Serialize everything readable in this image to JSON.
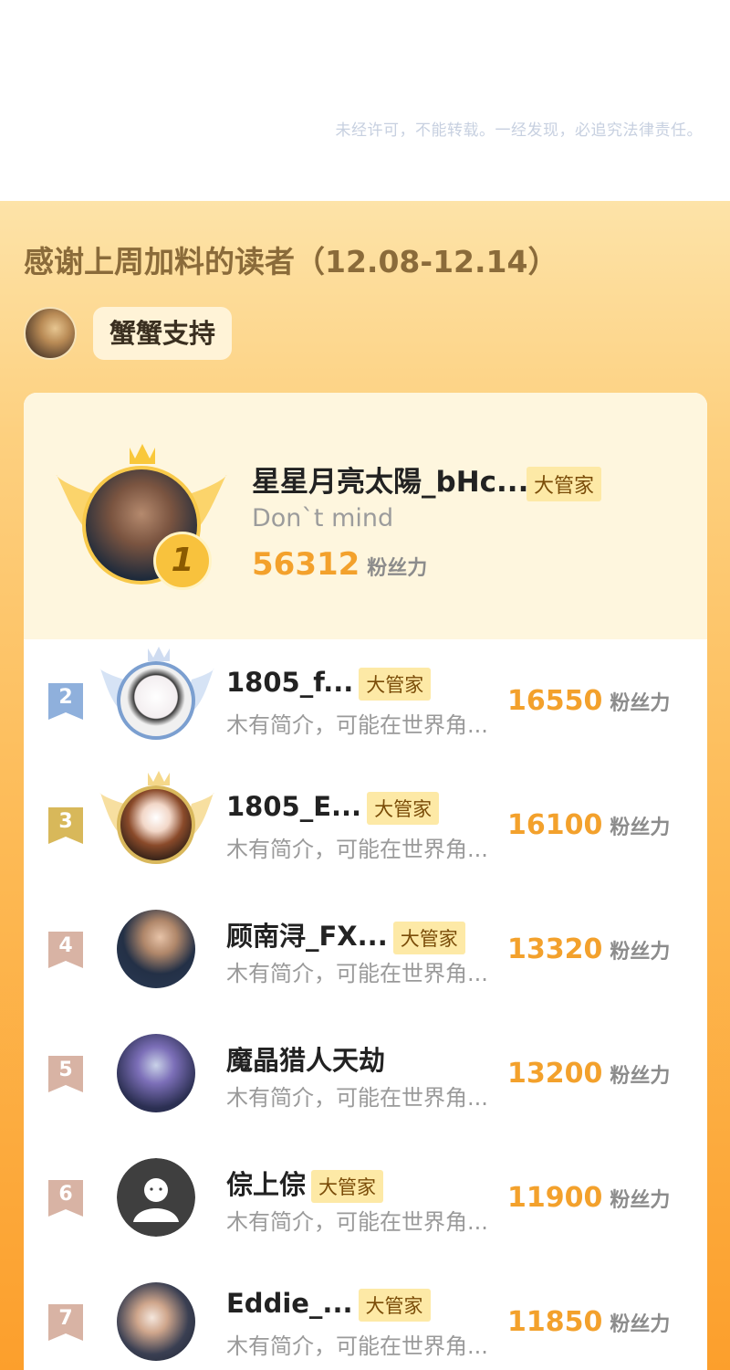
{
  "copyright": "未经许可，不能转载。一经发现，必追究法律责任。",
  "heading": "感谢上周加料的读者（12.08-12.14）",
  "sponsor": {
    "label": "蟹蟹支持"
  },
  "score_unit": "粉丝力",
  "colors": {
    "accent": "#f3a12c",
    "badge_bg": "#fde9a6",
    "panel_top": "#fde3a8",
    "panel_bottom": "#fc9f2c"
  },
  "top1": {
    "rank": "1",
    "name": "星星月亮太陽_bHc...",
    "badge": "大管家",
    "bio": "Don`t mind",
    "score": "56312"
  },
  "rows": [
    {
      "rank": "2",
      "name": "1805_f...",
      "badge": "大管家",
      "bio": "木有简介，可能在世界角...",
      "score": "16550"
    },
    {
      "rank": "3",
      "name": "1805_E...",
      "badge": "大管家",
      "bio": "木有简介，可能在世界角...",
      "score": "16100"
    },
    {
      "rank": "4",
      "name": "顾南浔_FX...",
      "badge": "大管家",
      "bio": "木有简介，可能在世界角...",
      "score": "13320"
    },
    {
      "rank": "5",
      "name": "魔晶猎人天劫",
      "badge": "",
      "bio": "木有简介，可能在世界角...",
      "score": "13200"
    },
    {
      "rank": "6",
      "name": "倧上倧",
      "badge": "大管家",
      "bio": "木有简介，可能在世界角...",
      "score": "11900"
    },
    {
      "rank": "7",
      "name": "Eddie_...",
      "badge": "大管家",
      "bio": "木有简介，可能在世界角...",
      "score": "11850"
    }
  ]
}
